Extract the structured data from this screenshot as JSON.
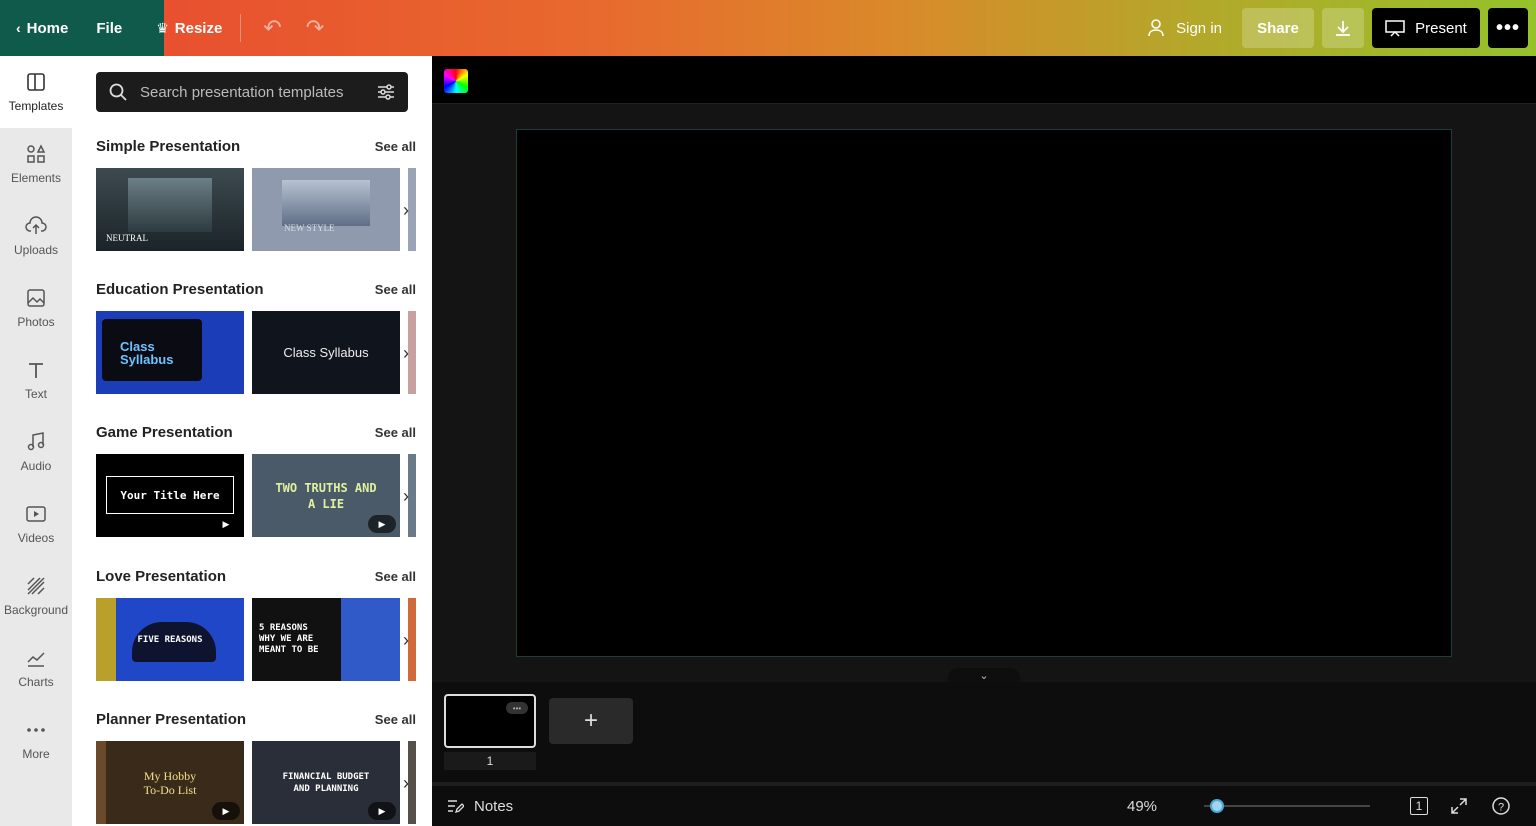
{
  "topbar": {
    "home_label": "Home",
    "file_label": "File",
    "resize_label": "Resize",
    "signin_label": "Sign in",
    "share_label": "Share",
    "present_label": "Present"
  },
  "sidenav": {
    "items": [
      {
        "label": "Templates",
        "icon": "templates-icon"
      },
      {
        "label": "Elements",
        "icon": "elements-icon"
      },
      {
        "label": "Uploads",
        "icon": "uploads-icon"
      },
      {
        "label": "Photos",
        "icon": "photos-icon"
      },
      {
        "label": "Text",
        "icon": "text-icon"
      },
      {
        "label": "Audio",
        "icon": "audio-icon"
      },
      {
        "label": "Videos",
        "icon": "videos-icon"
      },
      {
        "label": "Background",
        "icon": "background-icon"
      },
      {
        "label": "Charts",
        "icon": "charts-icon"
      },
      {
        "label": "More",
        "icon": "more-icon"
      }
    ]
  },
  "panel": {
    "search_placeholder": "Search presentation templates",
    "see_all": "See all",
    "sections": [
      {
        "title": "Simple Presentation",
        "thumbs": [
          "NEUTRAL",
          "NEW STYLE"
        ]
      },
      {
        "title": "Education Presentation",
        "thumbs": [
          "Class Syllabus",
          "Class Syllabus"
        ]
      },
      {
        "title": "Game Presentation",
        "thumbs": [
          "Your Title Here",
          "TWO TRUTHS AND A LIE"
        ]
      },
      {
        "title": "Love Presentation",
        "thumbs": [
          "FIVE REASONS",
          "5 REASONS WHY WE ARE MEANT TO BE"
        ]
      },
      {
        "title": "Planner Presentation",
        "thumbs": [
          "My Hobby To-Do List",
          "FINANCIAL BUDGET AND PLANNING"
        ]
      }
    ]
  },
  "pages": {
    "page_number": "1"
  },
  "footer": {
    "notes_label": "Notes",
    "zoom": "49%",
    "zoom_fraction": 0.08,
    "page_count_icon": "1"
  }
}
